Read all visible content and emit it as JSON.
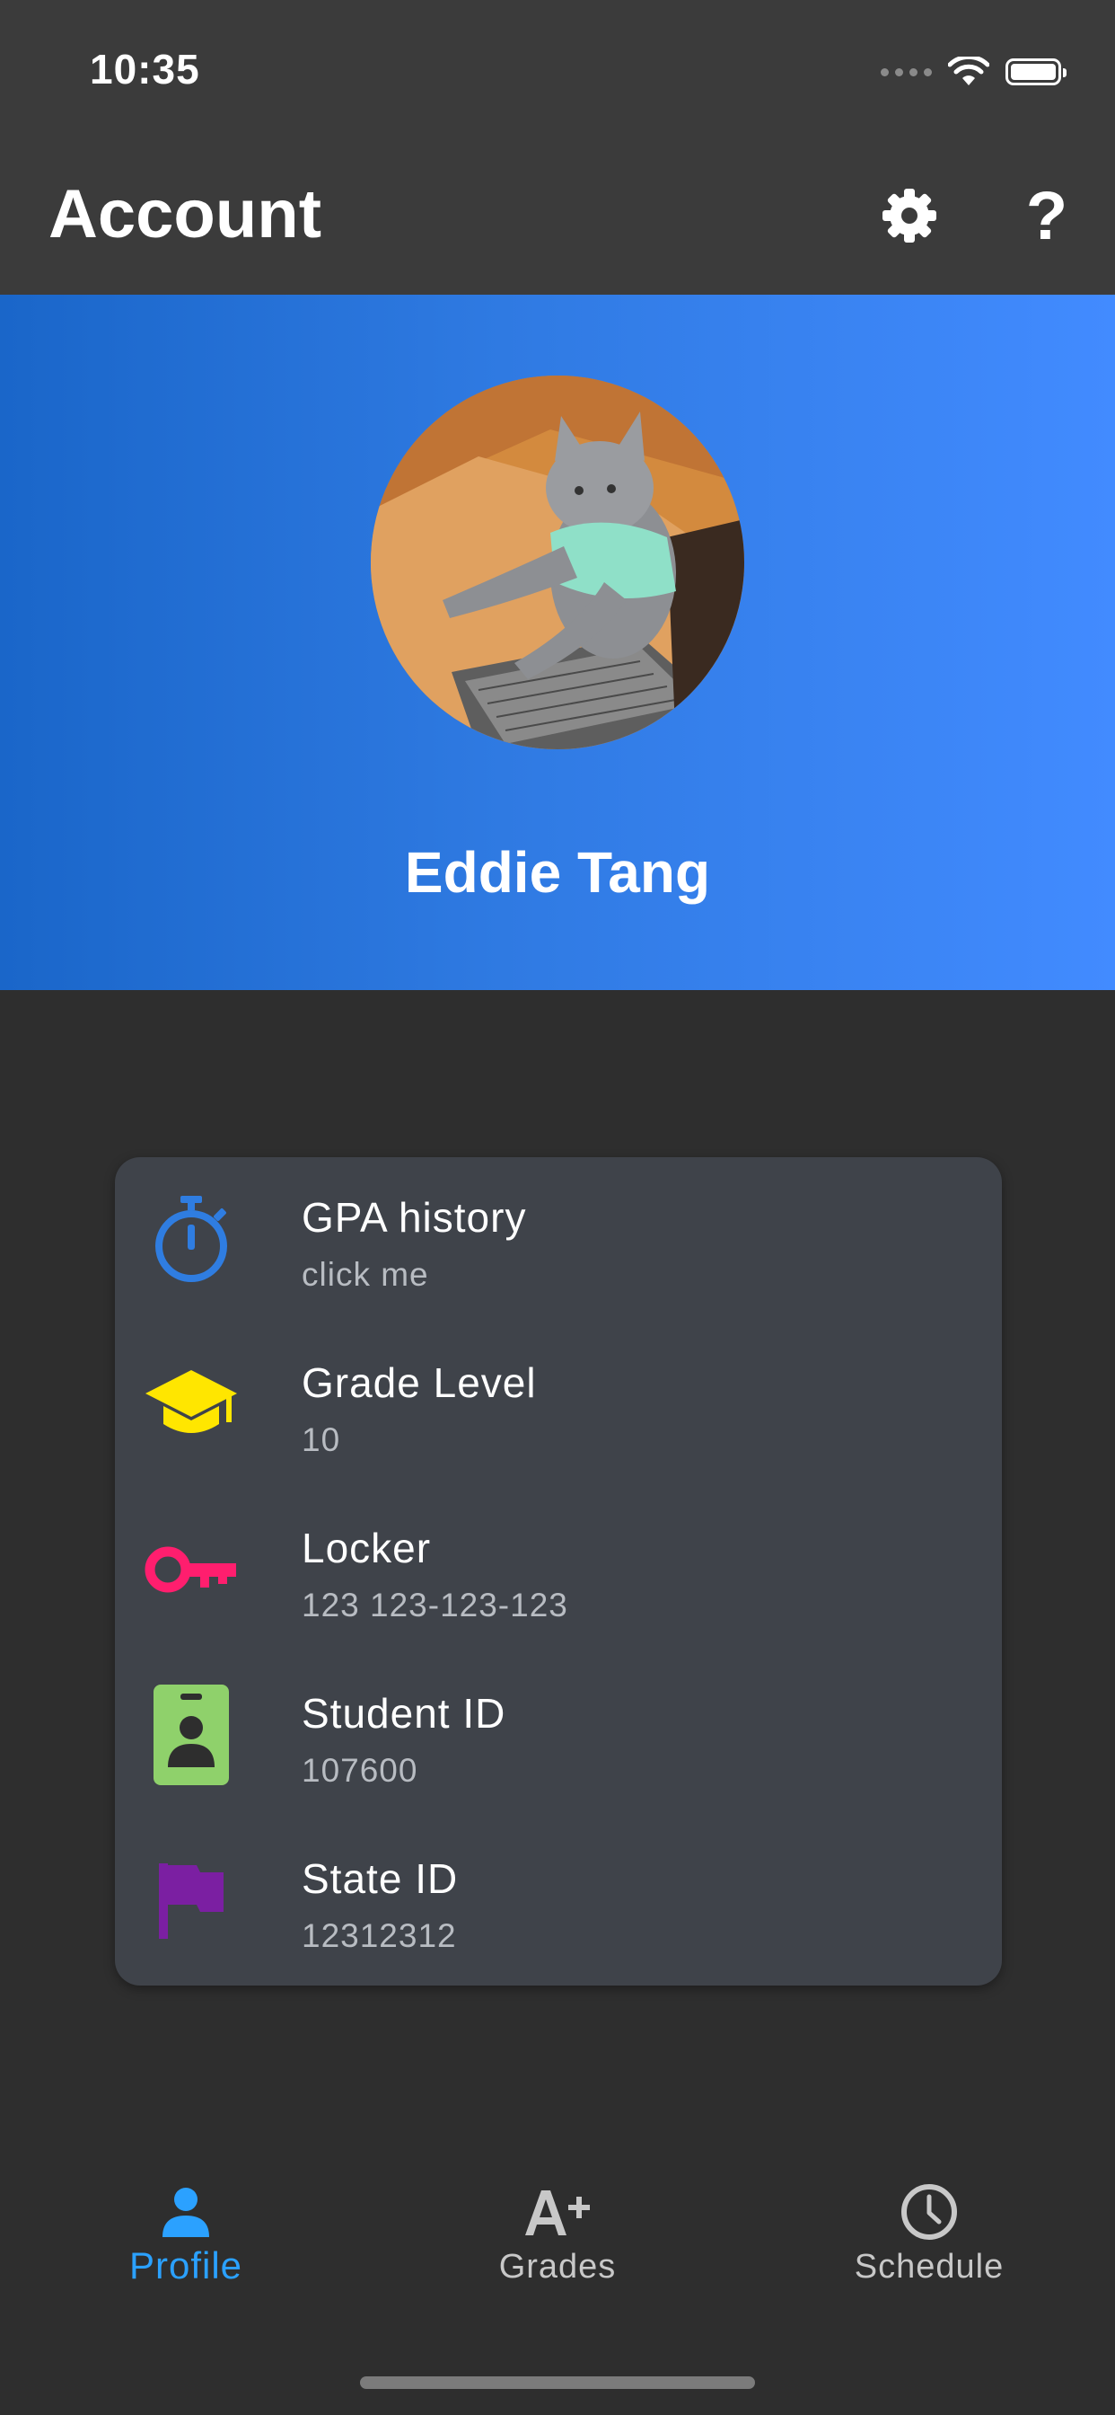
{
  "status_bar": {
    "time": "10:35"
  },
  "app_bar": {
    "title": "Account",
    "settings_icon": "gear-icon",
    "help_label": "?"
  },
  "profile": {
    "name": "Eddie Tang",
    "avatar": "cat-typing-photo"
  },
  "info_items": [
    {
      "icon": "stopwatch-icon",
      "color": "#2f7de1",
      "title": "GPA history",
      "subtitle": "click me"
    },
    {
      "icon": "graduation-cap-icon",
      "color": "#ffe600",
      "title": "Grade Level",
      "subtitle": "10"
    },
    {
      "icon": "key-icon",
      "color": "#ff1e6e",
      "title": "Locker",
      "subtitle": "123 123-123-123"
    },
    {
      "icon": "id-badge-icon",
      "color": "#8fd16b",
      "title": "Student ID",
      "subtitle": "107600"
    },
    {
      "icon": "flag-icon",
      "color": "#7b1fa2",
      "title": "State ID",
      "subtitle": "12312312"
    }
  ],
  "bottom_nav": [
    {
      "icon": "person-icon",
      "label": "Profile",
      "active": true,
      "color": "#2ba1ff"
    },
    {
      "icon": "a-plus-icon",
      "label": "Grades",
      "active": false,
      "color": "#c8c8c8"
    },
    {
      "icon": "clock-icon",
      "label": "Schedule",
      "active": false,
      "color": "#c8c8c8"
    }
  ]
}
